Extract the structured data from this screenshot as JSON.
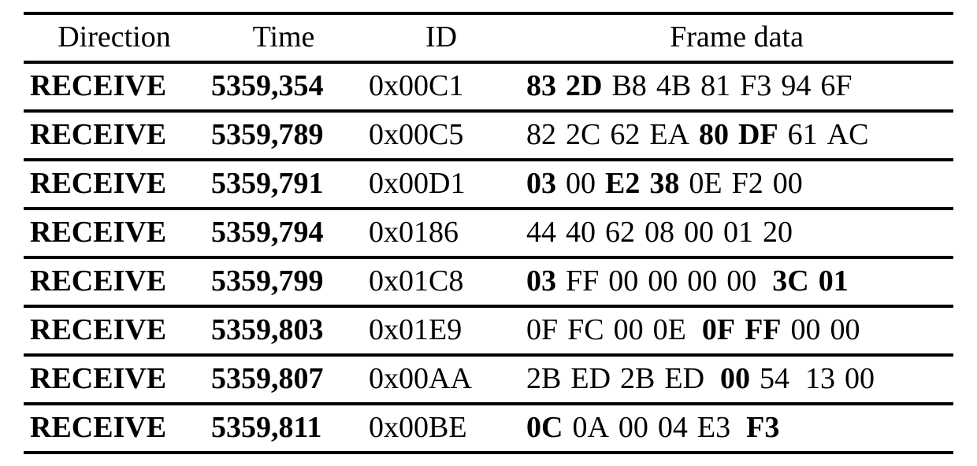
{
  "headers": {
    "direction": "Direction",
    "time": "Time",
    "id": "ID",
    "frame": "Frame data"
  },
  "rows": [
    {
      "direction": "RECEIVE",
      "time": "5359,354",
      "id": "0x00C1",
      "frame_parts": [
        {
          "t": "83",
          "bold": true
        },
        {
          "gap": 1
        },
        {
          "t": "2D",
          "bold": true
        },
        {
          "gap": 1
        },
        {
          "t": "B8"
        },
        {
          "gap": 1
        },
        {
          "t": "4B"
        },
        {
          "gap": 1
        },
        {
          "t": "81"
        },
        {
          "gap": 1
        },
        {
          "t": "F3"
        },
        {
          "gap": 1
        },
        {
          "t": "94"
        },
        {
          "gap": 1
        },
        {
          "t": "6F"
        }
      ]
    },
    {
      "direction": "RECEIVE",
      "time": "5359,789",
      "id": "0x00C5",
      "frame_parts": [
        {
          "t": "82"
        },
        {
          "gap": 1
        },
        {
          "t": "2C"
        },
        {
          "gap": 1
        },
        {
          "t": "62"
        },
        {
          "gap": 1
        },
        {
          "t": "EA"
        },
        {
          "gap": 1
        },
        {
          "t": "80",
          "bold": true
        },
        {
          "gap": 1
        },
        {
          "t": "DF",
          "bold": true
        },
        {
          "gap": 1
        },
        {
          "t": "61"
        },
        {
          "gap": 1
        },
        {
          "t": "AC"
        }
      ]
    },
    {
      "direction": "RECEIVE",
      "time": "5359,791",
      "id": "0x00D1",
      "frame_parts": [
        {
          "t": "03",
          "bold": true
        },
        {
          "gap": 1
        },
        {
          "t": "00"
        },
        {
          "gap": 1
        },
        {
          "t": "E2",
          "bold": true
        },
        {
          "gap": 1
        },
        {
          "t": "38",
          "bold": true
        },
        {
          "gap": 1
        },
        {
          "t": "0E"
        },
        {
          "gap": 1
        },
        {
          "t": "F2"
        },
        {
          "gap": 1
        },
        {
          "t": "00"
        }
      ]
    },
    {
      "direction": "RECEIVE",
      "time": "5359,794",
      "id": "0x0186",
      "frame_parts": [
        {
          "t": "44"
        },
        {
          "gap": 1
        },
        {
          "t": "40"
        },
        {
          "gap": 1
        },
        {
          "t": "62"
        },
        {
          "gap": 1
        },
        {
          "t": "08"
        },
        {
          "gap": 1
        },
        {
          "t": "00"
        },
        {
          "gap": 1
        },
        {
          "t": "01"
        },
        {
          "gap": 1
        },
        {
          "t": "20"
        }
      ]
    },
    {
      "direction": "RECEIVE",
      "time": "5359,799",
      "id": "0x01C8",
      "frame_parts": [
        {
          "t": "03",
          "bold": true
        },
        {
          "gap": 1
        },
        {
          "t": "FF"
        },
        {
          "gap": 1
        },
        {
          "t": "00"
        },
        {
          "gap": 1
        },
        {
          "t": "00"
        },
        {
          "gap": 1
        },
        {
          "t": "00"
        },
        {
          "gap": 1
        },
        {
          "t": "00"
        },
        {
          "gap": 2
        },
        {
          "t": "3C",
          "bold": true
        },
        {
          "gap": 1
        },
        {
          "t": "01",
          "bold": true
        }
      ]
    },
    {
      "direction": "RECEIVE",
      "time": "5359,803",
      "id": "0x01E9",
      "frame_parts": [
        {
          "t": "0F"
        },
        {
          "gap": 1
        },
        {
          "t": "FC"
        },
        {
          "gap": 1
        },
        {
          "t": "00"
        },
        {
          "gap": 1
        },
        {
          "t": "0E"
        },
        {
          "gap": 2
        },
        {
          "t": "0F",
          "bold": true
        },
        {
          "gap": 1
        },
        {
          "t": "FF",
          "bold": true
        },
        {
          "gap": 1
        },
        {
          "t": "00"
        },
        {
          "gap": 1
        },
        {
          "t": "00"
        }
      ]
    },
    {
      "direction": "RECEIVE",
      "time": "5359,807",
      "id": "0x00AA",
      "frame_parts": [
        {
          "t": "2B"
        },
        {
          "gap": 1
        },
        {
          "t": "ED"
        },
        {
          "gap": 1
        },
        {
          "t": "2B"
        },
        {
          "gap": 1
        },
        {
          "t": "ED"
        },
        {
          "gap": 2
        },
        {
          "t": "00",
          "bold": true
        },
        {
          "gap": 1
        },
        {
          "t": "54"
        },
        {
          "gap": 2
        },
        {
          "t": "13"
        },
        {
          "gap": 1
        },
        {
          "t": "00"
        }
      ]
    },
    {
      "direction": "RECEIVE",
      "time": "5359,811",
      "id": "0x00BE",
      "frame_parts": [
        {
          "t": "0C",
          "bold": true
        },
        {
          "gap": 1
        },
        {
          "t": "0A"
        },
        {
          "gap": 1
        },
        {
          "t": "00"
        },
        {
          "gap": 1
        },
        {
          "t": "04"
        },
        {
          "gap": 1
        },
        {
          "t": "E3"
        },
        {
          "gap": 2
        },
        {
          "t": "F3",
          "bold": true
        }
      ]
    }
  ]
}
